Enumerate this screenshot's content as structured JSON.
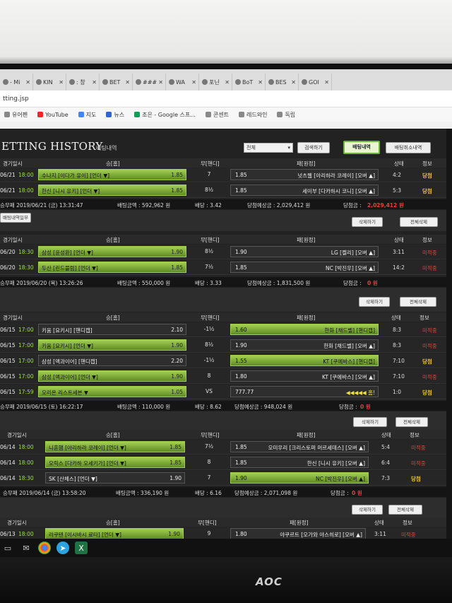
{
  "browser": {
    "tabs": [
      {
        "label": "- Mi"
      },
      {
        "label": "KIN"
      },
      {
        "label": ": 창"
      },
      {
        "label": "BET"
      },
      {
        "label": "###"
      },
      {
        "label": "WA"
      },
      {
        "label": "포닌"
      },
      {
        "label": "BoT"
      },
      {
        "label": "BES"
      },
      {
        "label": "GOI"
      }
    ],
    "address": "tting.jsp",
    "bookmarks": [
      "유어펜",
      "YouTube",
      "지도",
      "뉴스",
      "조은 - Google 스프...",
      "콘센트",
      "레드와인",
      "독립"
    ]
  },
  "header": {
    "title": "ETTING HISTORY",
    "subtitle": "베팅내역",
    "select_value": "전체",
    "btn_search": "검색하기",
    "btn_history": "배팅내역",
    "btn_cancel_history": "배팅취소내역"
  },
  "columns": {
    "date": "경기일시",
    "home": "승[홈]",
    "draw": "무[핸디]",
    "away": "패[원정]",
    "state": "상태",
    "info": "정보"
  },
  "sections": [
    {
      "rows": [
        {
          "date": "06/21",
          "time": "18:00",
          "home": "수나지 [이다가 유이] [언더 ▼]",
          "home_odds": "1.85",
          "home_sel": true,
          "mid": "7",
          "away_odds": "1.85",
          "away": "넛츠웹 [아리하라 코레이] [오버 ▲]",
          "away_sel": false,
          "score": "4:2",
          "status": "당첨",
          "status_type": "win"
        },
        {
          "date": "06/21",
          "time": "18:00",
          "home": "한신 [니시 유키] [언더 ▼]",
          "home_odds": "1.85",
          "home_sel": true,
          "mid": "8½",
          "away_odds": "1.85",
          "away": "세이부 [다카하시 코니] [오버 ▲]",
          "away_sel": false,
          "score": "5:3",
          "status": "당첨",
          "status_type": "win"
        }
      ],
      "summary": {
        "time": "승무패 2019/06/21 (금) 13:31:47",
        "amount": "배팅금액 : 592,962 원",
        "rate": "배당 : 3.42",
        "expected": "당첨예상금 : 2,029,412 원",
        "win_label": "당첨금 :",
        "win_value": "2,029,412 원"
      },
      "extra_btn": "배팅내역일부",
      "btn_delete": "삭제하기",
      "btn_delete_all": "전체삭제"
    },
    {
      "rows": [
        {
          "date": "06/20",
          "time": "18:30",
          "home": "삼성 [윤성환] [언더 ▼]",
          "home_odds": "1.90",
          "home_sel": true,
          "mid": "8½",
          "away_odds": "1.90",
          "away": "LG [켈리] [오버 ▲]",
          "away_sel": false,
          "score": "3:11",
          "status": "미적중",
          "status_type": "miss"
        },
        {
          "date": "06/20",
          "time": "18:30",
          "home": "두산 [린드블럼] [언더 ▼]",
          "home_odds": "1.85",
          "home_sel": true,
          "mid": "7½",
          "away_odds": "1.85",
          "away": "NC [박진우] [오버 ▲]",
          "away_sel": false,
          "score": "14:2",
          "status": "미적중",
          "status_type": "miss"
        }
      ],
      "summary": {
        "time": "승무패 2019/06/20 (목) 13:26:26",
        "amount": "배팅금액 : 550,000 원",
        "rate": "배당 : 3.33",
        "expected": "당첨예상금 : 1,831,500 원",
        "win_label": "당첨금 :",
        "win_value": "0 원"
      },
      "btn_delete": "삭제하기",
      "btn_delete_all": "전체삭제"
    },
    {
      "rows": [
        {
          "date": "06/15",
          "time": "17:00",
          "home": "키움 [요키시] [핸디캡]",
          "home_odds": "2.10",
          "home_sel": false,
          "mid": "-1½",
          "away_odds": "1.60",
          "away": "한화 [채드벨] [핸디캡]",
          "away_sel": true,
          "score": "8:3",
          "status": "미적중",
          "status_type": "miss"
        },
        {
          "date": "06/15",
          "time": "17:00",
          "home": "키움 [요키시] [언더 ▼]",
          "home_odds": "1.90",
          "home_sel": true,
          "mid": "8½",
          "away_odds": "1.90",
          "away": "한화 [채드벨] [오버 ▲]",
          "away_sel": false,
          "score": "8:3",
          "status": "미적중",
          "status_type": "miss"
        },
        {
          "date": "06/15",
          "time": "17:00",
          "home": "삼성 [맥과이어] [핸디캡]",
          "home_odds": "2.20",
          "home_sel": false,
          "mid": "-1½",
          "away_odds": "1.55",
          "away": "KT [쿠에바스] [핸디캡]",
          "away_sel": true,
          "score": "7:10",
          "status": "당첨",
          "status_type": "win"
        },
        {
          "date": "06/15",
          "time": "17:00",
          "home": "삼성 [맥과이어] [언더 ▼]",
          "home_odds": "1.90",
          "home_sel": true,
          "mid": "8",
          "away_odds": "1.80",
          "away": "KT [쿠에바스] [오버 ▲]",
          "away_sel": false,
          "score": "7:10",
          "status": "미적중",
          "status_type": "miss"
        },
        {
          "date": "06/15",
          "time": "17:59",
          "home": "오리온 리스트세븐 ▼",
          "home_odds": "1.05",
          "home_sel": true,
          "mid": "VS",
          "away_odds": "777.77",
          "away": "◀◀◀◀◀ 홈!",
          "away_sel": false,
          "away_yellow": true,
          "score": "1:0",
          "status": "당첨",
          "status_type": "win"
        }
      ],
      "summary": {
        "time": "승무패 2019/06/15 (토) 16:22:17",
        "amount": "배팅금액 : 110,000 원",
        "rate": "배당 : 8.62",
        "expected": "당첨예상금 : 948,024 원",
        "win_label": "당첨금 :",
        "win_value": "0 원"
      },
      "btn_delete": "삭제하기",
      "btn_delete_all": "전체삭제"
    },
    {
      "rows": [
        {
          "date": "06/14",
          "time": "18:00",
          "home": "니혼햄 [아리하라 코레이] [언더 ▼]",
          "home_odds": "1.85",
          "home_sel": true,
          "mid": "7½",
          "away_odds": "1.85",
          "away": "오미우리 [크리스토퍼 머르세데스] [오버 ▲]",
          "away_sel": false,
          "score": "5:4",
          "status": "미적중",
          "status_type": "miss"
        },
        {
          "date": "06/14",
          "time": "18:00",
          "home": "오릭스 [다카하 오세키가] [언더 ▼]",
          "home_odds": "1.85",
          "home_sel": true,
          "mid": "8",
          "away_odds": "1.85",
          "away": "한신 [니시 유키] [오버 ▲]",
          "away_sel": false,
          "score": "6:4",
          "status": "미적중",
          "status_type": "miss"
        },
        {
          "date": "06/14",
          "time": "18:30",
          "home": "SK [산체스] [언더 ▼]",
          "home_odds": "1.90",
          "home_sel": false,
          "mid": "7",
          "away_odds": "1.90",
          "away": "NC [박진우] [오버 ▲]",
          "away_sel": true,
          "score": "7:3",
          "status": "당첨",
          "status_type": "win"
        }
      ],
      "summary": {
        "time": "승무패 2019/06/14 (금) 13:58:20",
        "amount": "배팅금액 : 336,190 원",
        "rate": "배당 : 6.16",
        "expected": "당첨예상금 : 2,071,098 원",
        "win_label": "당첨금 :",
        "win_value": "0 원"
      },
      "btn_delete": "삭제하기",
      "btn_delete_all": "전체삭제"
    },
    {
      "rows": [
        {
          "date": "06/13",
          "time": "18:00",
          "home": "라쿠텐 [이시바시 료타] [언더 ▼]",
          "home_odds": "1.90",
          "home_sel": true,
          "mid": "9",
          "away_odds": "1.80",
          "away": "야쿠르트 [오가와 야스히로] [오버 ▲]",
          "away_sel": false,
          "score": "3:11",
          "status": "미적중",
          "status_type": "miss"
        }
      ]
    }
  ],
  "monitor": {
    "brand": "AOC"
  },
  "colors": {
    "accent_green": "#9ddc4a",
    "win": "#f1c233",
    "miss": "#d9463b",
    "win_amount": "#e83d3d"
  }
}
